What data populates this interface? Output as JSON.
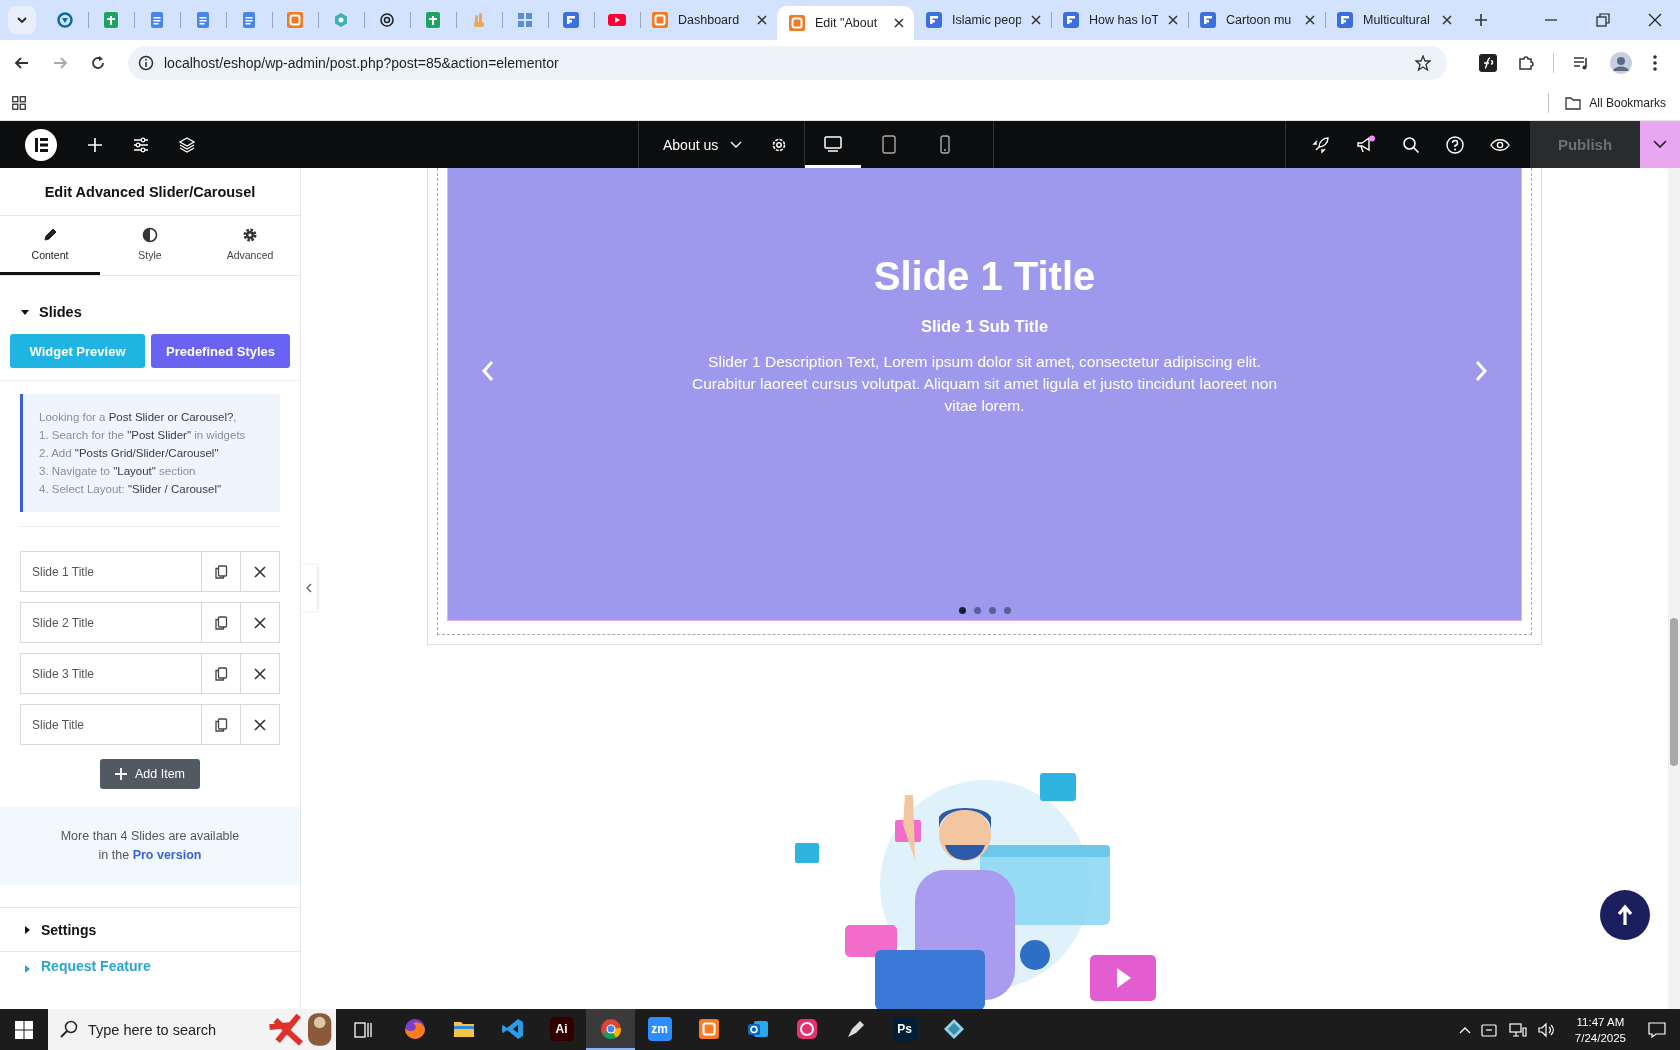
{
  "browser": {
    "tabs": [
      {
        "kind": "ring",
        "color": "#0b6e99",
        "selected": false
      },
      {
        "kind": "sheet",
        "color": "#1ea362",
        "selected": false
      },
      {
        "kind": "doc",
        "color": "#4a86e8",
        "selected": false
      },
      {
        "kind": "doc",
        "color": "#4a86e8",
        "selected": false
      },
      {
        "kind": "doc",
        "color": "#4a86e8",
        "selected": false
      },
      {
        "kind": "xampp",
        "color": "#f27a24",
        "selected": false
      },
      {
        "kind": "hex",
        "color": "#3fb1b5",
        "selected": false
      },
      {
        "kind": "knot",
        "color": "#222222",
        "selected": false
      },
      {
        "kind": "sheet",
        "color": "#1ea362",
        "selected": false
      },
      {
        "kind": "hand",
        "color": "#e8a75b",
        "selected": false
      },
      {
        "kind": "grid",
        "color": "#5a8fd6",
        "selected": false
      },
      {
        "kind": "form",
        "color": "#3b6fe0",
        "selected": false
      },
      {
        "kind": "video",
        "color": "#ff0033",
        "selected": false
      },
      {
        "kind": "xampp",
        "color": "#f27a24",
        "label": "Dashboard",
        "selected": false
      },
      {
        "kind": "xampp",
        "color": "#f27a24",
        "label": "Edit \"About",
        "selected": true
      },
      {
        "kind": "form",
        "color": "#3b6fe0",
        "label": "Islamic peop",
        "selected": false
      },
      {
        "kind": "form",
        "color": "#3b6fe0",
        "label": "How has IoT",
        "selected": false
      },
      {
        "kind": "form",
        "color": "#3b6fe0",
        "label": "Cartoon mu",
        "selected": false
      },
      {
        "kind": "form",
        "color": "#3b6fe0",
        "label": "Multicultural",
        "selected": false
      }
    ],
    "address": "localhost/eshop/wp-admin/post.php?post=85&action=elementor",
    "bookmarks_folder": "All Bookmarks"
  },
  "editor_bar": {
    "page": "About us",
    "devices": [
      {
        "kind": "desktop",
        "selected": true
      },
      {
        "kind": "tablet",
        "selected": false
      },
      {
        "kind": "mobile",
        "selected": false
      }
    ],
    "publish": {
      "label": "Publish",
      "disabled": true
    }
  },
  "panel": {
    "title": "Edit Advanced Slider/Carousel",
    "tabs": [
      {
        "kind": "pencil",
        "label": "Content",
        "selected": true
      },
      {
        "kind": "contrast",
        "label": "Style",
        "selected": false
      },
      {
        "kind": "gear",
        "label": "Advanced",
        "selected": false
      }
    ],
    "slides_section": {
      "title": "Slides",
      "expanded": true,
      "buttons": [
        {
          "kind": "preview",
          "label": "Widget Preview"
        },
        {
          "kind": "styles",
          "label": "Predefined Styles"
        }
      ],
      "note": [
        "Looking for a **Post Slider or Carousel?**,",
        "1. Search for the **\"Post Slider\"** in widgets",
        "2. Add **\"Posts Grid/Slider/Carousel\"**",
        "3. Navigate to **\"Layout\"** section",
        "4. Select Layout: **\"Slider / Carousel\"**"
      ],
      "items": [
        {
          "title": "Slide 1 Title"
        },
        {
          "title": "Slide 2 Title"
        },
        {
          "title": "Slide 3 Title"
        },
        {
          "title": "Slide Title"
        }
      ],
      "add_button": "Add Item"
    },
    "pro_notice": {
      "text": "More than 4 Slides are available in the",
      "link": "Pro version"
    },
    "sections": [
      {
        "kind": "plain",
        "title": "Settings",
        "expanded": false
      },
      {
        "kind": "link",
        "title": "Request Feature",
        "expanded": false
      }
    ]
  },
  "slider": {
    "title": "Slide 1 Title",
    "subtitle": "Slide 1 Sub Title",
    "description": "Slider 1 Description Text, Lorem ipsum dolor sit amet, consectetur adipiscing elit. Curabitur laoreet cursus volutpat. Aliquam sit amet ligula et justo tincidunt laoreet non vitae lorem.",
    "dots": [
      {
        "selected": true
      },
      {
        "selected": false
      },
      {
        "selected": false
      },
      {
        "selected": false
      }
    ]
  },
  "taskbar": {
    "search_placeholder": "Type here to search",
    "apps": [
      {
        "kind": "fox",
        "selected": false
      },
      {
        "kind": "folder",
        "selected": false
      },
      {
        "kind": "code",
        "selected": false
      },
      {
        "kind": "tile",
        "label": "Ai",
        "color": "#330000",
        "selected": false
      },
      {
        "kind": "chrome",
        "selected": true
      },
      {
        "kind": "tile",
        "label": "zm",
        "color": "#2d8cff",
        "selected": false
      },
      {
        "kind": "xampp",
        "selected": false
      },
      {
        "kind": "mail",
        "selected": false
      },
      {
        "kind": "cloud",
        "selected": false
      },
      {
        "kind": "pen",
        "selected": false
      },
      {
        "kind": "tile",
        "label": "Ps",
        "color": "#001e36",
        "selected": false
      },
      {
        "kind": "gem",
        "selected": false
      }
    ],
    "time": "11:47 AM",
    "date": "7/24/2025"
  }
}
